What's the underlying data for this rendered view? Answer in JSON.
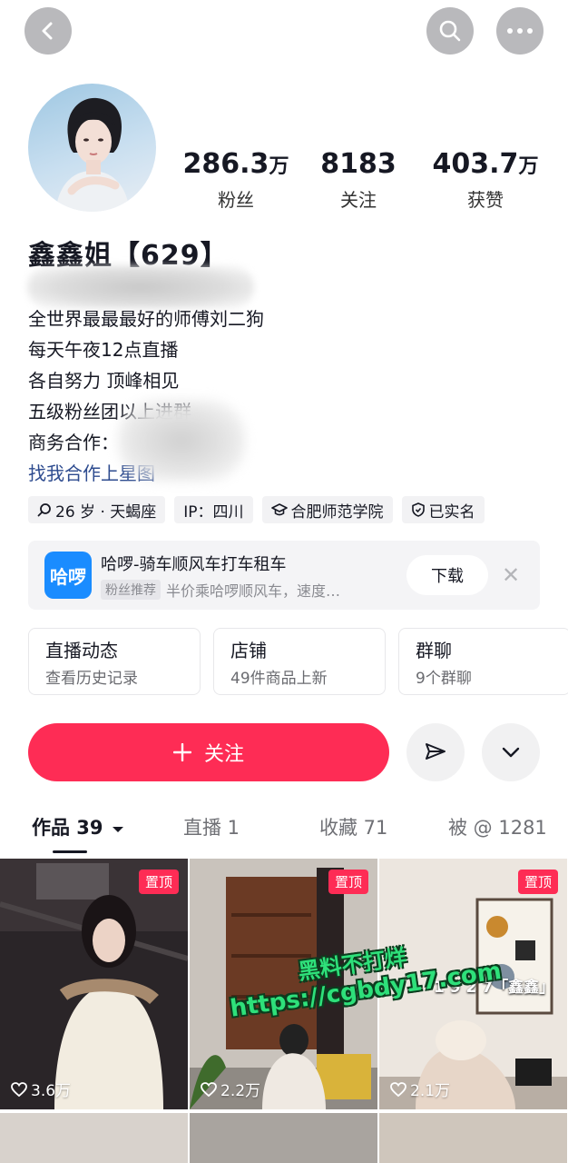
{
  "top_bar": {
    "back_icon": "chevron-left-icon",
    "search_icon": "search-icon",
    "more_icon": "more-dots-icon"
  },
  "profile": {
    "nickname": "鑫鑫姐【629】",
    "stats": [
      {
        "value": "286.3",
        "unit": "万",
        "label": "粉丝"
      },
      {
        "value": "8183",
        "unit": "",
        "label": "关注"
      },
      {
        "value": "403.7",
        "unit": "万",
        "label": "获赞"
      }
    ],
    "bio": [
      "全世界最最最好的师傅刘二狗",
      "每天午夜12点直播",
      "各自努力 顶峰相见",
      "五级粉丝团以上进群",
      "商务合作："
    ],
    "bio_link": "找我合作上星图",
    "tags": [
      {
        "icon": "search-icon",
        "text": "26 岁 · 天蝎座"
      },
      {
        "icon": "",
        "text": "IP：四川"
      },
      {
        "icon": "graduation-cap-icon",
        "text": "合肥师范学院"
      },
      {
        "icon": "shield-check-icon",
        "text": "已实名"
      }
    ]
  },
  "ad": {
    "logo_text": "哈啰",
    "title": "哈啰-骑车顺风车打车租车",
    "badge": "粉丝推荐",
    "subtitle": "半价乘哈啰顺风车，速度…",
    "download_label": "下载",
    "close_icon": "close-icon"
  },
  "entries": [
    {
      "title": "直播动态",
      "subtitle": "查看历史记录"
    },
    {
      "title": "店铺",
      "subtitle": "49件商品上新"
    },
    {
      "title": "群聊",
      "subtitle": "9个群聊"
    }
  ],
  "actions": {
    "follow_label": "关注",
    "follow_icon": "plus-icon",
    "share_icon": "send-icon",
    "expand_icon": "chevron-down-icon"
  },
  "tabs": [
    {
      "label": "作品 39",
      "active": true
    },
    {
      "label": "直播 1",
      "active": false
    },
    {
      "label": "收藏 71",
      "active": false
    },
    {
      "label": "被 @ 1281",
      "active": false
    }
  ],
  "videos": [
    {
      "pinned_label": "置顶",
      "likes": "3.6万"
    },
    {
      "pinned_label": "置顶",
      "likes": "2.2万"
    },
    {
      "pinned_label": "置顶",
      "likes": "2.1万"
    }
  ],
  "overlay_text": {
    "video_caption": "1 9 2 7「鑫鑫」",
    "watermark_line1": "黑料不打烊",
    "watermark_line2": "https://cgbdy17.com"
  },
  "colors": {
    "accent": "#fe2c55",
    "ad_logo": "#1a8cff",
    "link": "#2d4b8f",
    "watermark": "#2ee07a"
  }
}
